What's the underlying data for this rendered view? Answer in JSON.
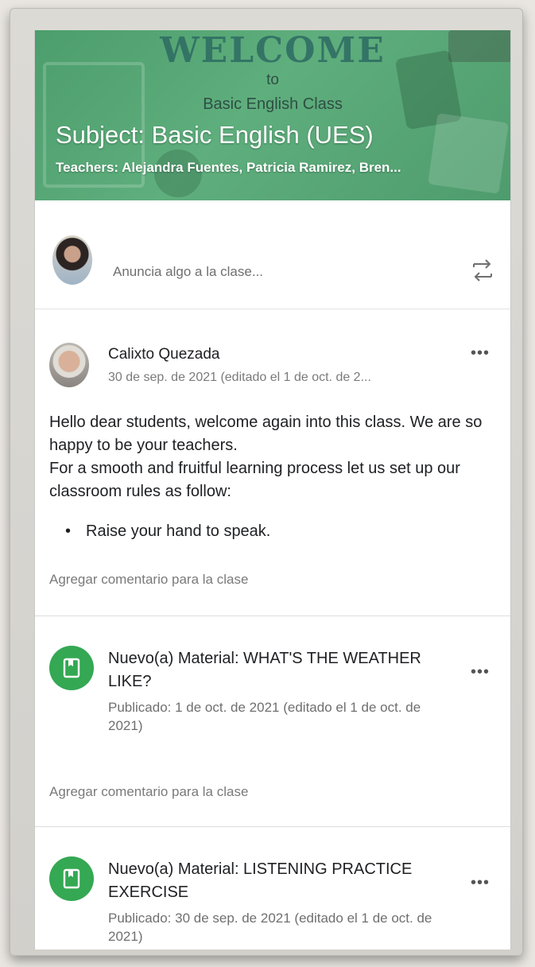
{
  "banner": {
    "welcome": "WELCOME",
    "to": "to",
    "class_name": "Basic English Class",
    "subject": "Subject: Basic English (UES)",
    "teachers": "Teachers: Alejandra Fuentes, Patricia Ramirez, Bren..."
  },
  "announce": {
    "placeholder": "Anuncia algo a la clase..."
  },
  "posts": [
    {
      "author": "Calixto Quezada",
      "date": "30 de sep. de 2021 (editado el 1 de oct. de 2...",
      "body": [
        "Hello dear students, welcome again into this class. We are so happy to be your teachers.",
        "For a smooth and fruitful learning process let us set up our classroom rules as follow:"
      ],
      "bullet": "Raise your hand to speak.",
      "comment": "Agregar comentario para la clase"
    }
  ],
  "materials": [
    {
      "title": "Nuevo(a) Material: WHAT'S THE WEATHER LIKE?",
      "date": "Publicado: 1 de oct. de 2021 (editado el 1 de oct. de 2021)",
      "comment": "Agregar comentario para la clase"
    },
    {
      "title": "Nuevo(a) Material: LISTENING PRACTICE EXERCISE",
      "date": "Publicado: 30 de sep. de 2021 (editado el 1 de oct. de 2021)"
    }
  ],
  "icons": {
    "more": "more-horiz-icon",
    "repost": "repost-icon",
    "material": "book-icon"
  },
  "colors": {
    "accent": "#34a853",
    "banner": "#55a674"
  }
}
